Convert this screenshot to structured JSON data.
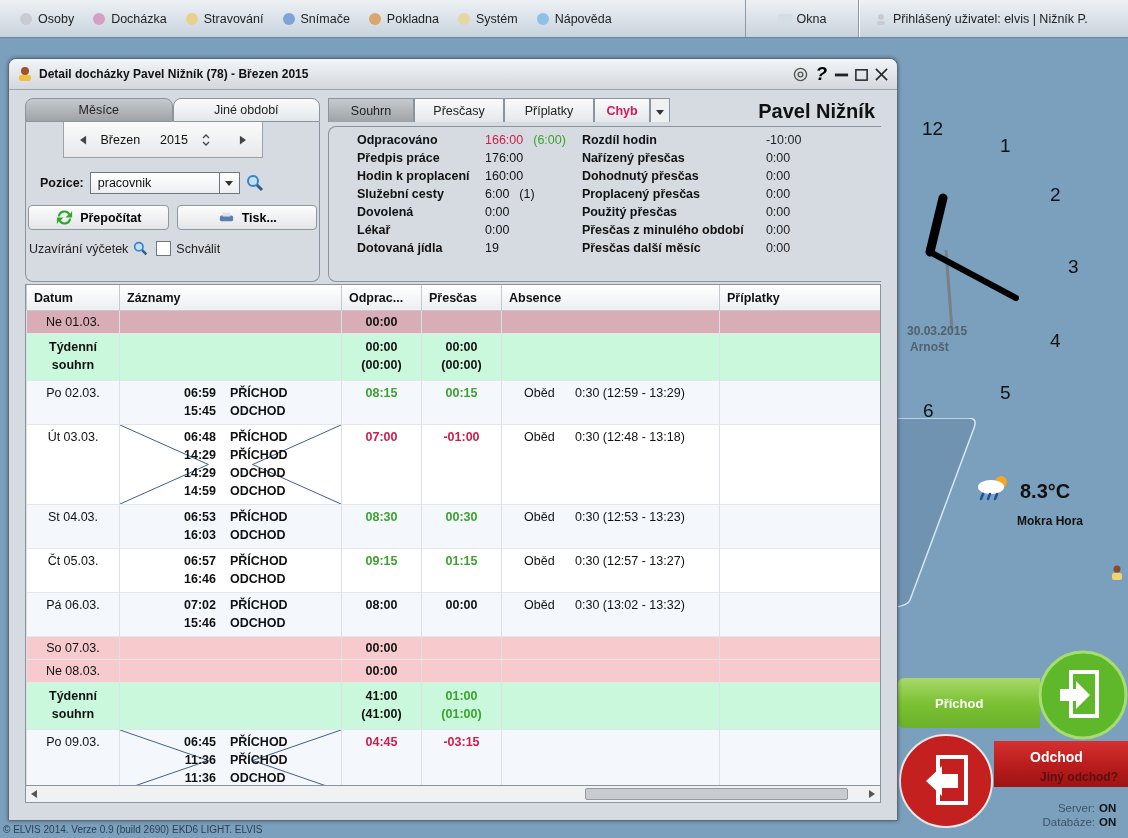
{
  "menu": {
    "items": [
      "Osoby",
      "Docházka",
      "Stravování",
      "Snímače",
      "Pokladna",
      "Systém",
      "Nápověda"
    ],
    "windows": "Okna",
    "user": "Přihlášený uživatel: elvis | Nižník P."
  },
  "dialog": {
    "title": "Detail docházky Pavel Nižník (78) - Březen 2015",
    "help": "?",
    "period_tabs": [
      {
        "label": "Měsíce",
        "selected": true
      },
      {
        "label": "Jiné období",
        "selected": false
      }
    ],
    "month": "Březen",
    "year": "2015",
    "position_label": "Pozice:",
    "position": "pracovnik",
    "recalc": "Přepočítat",
    "print": "Tisk...",
    "closing_label": "Uzavírání výčetek",
    "approve": {
      "label": "Schválit",
      "checked": false
    },
    "tabs": [
      {
        "label": "Souhrn",
        "selected": true,
        "kind": "normal"
      },
      {
        "label": "Přesčasy",
        "selected": false,
        "kind": "normal"
      },
      {
        "label": "Příplatky",
        "selected": false,
        "kind": "normal"
      },
      {
        "label": "Chyb",
        "selected": false,
        "kind": "error"
      }
    ],
    "person": "Pavel Nižník",
    "summary_left": [
      {
        "label": "Odpracováno",
        "parts": [
          {
            "text": "166:00",
            "color": "#d01c4a"
          },
          {
            "text": "(6:00)",
            "color": "#3aa32e"
          }
        ]
      },
      {
        "label": "Předpis práce",
        "parts": [
          {
            "text": "176:00",
            "color": "#111111"
          }
        ]
      },
      {
        "label": "Hodin k proplacení",
        "parts": [
          {
            "text": "160:00",
            "color": "#111111"
          }
        ]
      },
      {
        "label": "Služební cesty",
        "parts": [
          {
            "text": "6:00",
            "color": "#111111"
          },
          {
            "text": "(1)",
            "color": "#111111"
          }
        ]
      },
      {
        "label": "Dovolená",
        "parts": [
          {
            "text": "0:00",
            "color": "#111111"
          }
        ]
      },
      {
        "label": "Lékař",
        "parts": [
          {
            "text": "0:00",
            "color": "#111111"
          }
        ]
      },
      {
        "label": "Dotovaná jídla",
        "parts": [
          {
            "text": "19",
            "color": "#111111"
          }
        ]
      }
    ],
    "summary_right": [
      {
        "label": "Rozdíl hodin",
        "value": "-10:00"
      },
      {
        "label": "Nařízený přesčas",
        "value": "0:00"
      },
      {
        "label": "Dohodnutý přesčas",
        "value": "0:00"
      },
      {
        "label": "Proplacený přesčas",
        "value": "0:00"
      },
      {
        "label": "Použitý přesčas",
        "value": "0:00"
      },
      {
        "label": "Přesčas z minulého období",
        "value": "0:00"
      },
      {
        "label": "Přesčas další měsíc",
        "value": "0:00"
      }
    ],
    "columns": [
      "Datum",
      "Záznamy",
      "Odprac...",
      "Přesčas",
      "Absence",
      "Příplatky"
    ],
    "rows": [
      {
        "kind": "weekend",
        "selected": true,
        "date": "Ne 01.03.",
        "records": [],
        "worked": {
          "lines": [
            "00:00"
          ],
          "color": "#111111"
        },
        "crossed": false
      },
      {
        "kind": "week_summary",
        "selected": false,
        "date": "Týdenní souhrn",
        "records": [],
        "worked": {
          "lines": [
            "00:00",
            "(00:00)"
          ],
          "color": "#111111"
        },
        "overtime": {
          "lines": [
            "00:00",
            "(00:00)"
          ],
          "color": "#111111"
        },
        "crossed": false
      },
      {
        "kind": "day",
        "selected": false,
        "date": "Po 02.03.",
        "records": [
          {
            "time": "06:59",
            "type": "PŘÍCHOD"
          },
          {
            "time": "15:45",
            "type": "ODCHOD"
          }
        ],
        "worked": {
          "lines": [
            "08:15"
          ],
          "color": "#3aa32e"
        },
        "overtime": {
          "lines": [
            "00:15"
          ],
          "color": "#3aa32e"
        },
        "absence": {
          "type": "Oběd",
          "time": "0:30 (12:59 - 13:29)"
        },
        "crossed": false
      },
      {
        "kind": "day",
        "selected": false,
        "date": "Út 03.03.",
        "records": [
          {
            "time": "06:48",
            "type": "PŘÍCHOD"
          },
          {
            "time": "14:29",
            "type": "PŘÍCHOD"
          },
          {
            "time": "14:29",
            "type": "ODCHOD"
          },
          {
            "time": "14:59",
            "type": "ODCHOD"
          }
        ],
        "worked": {
          "lines": [
            "07:00"
          ],
          "color": "#d01c4a"
        },
        "overtime": {
          "lines": [
            "-01:00"
          ],
          "color": "#d01c4a"
        },
        "absence": {
          "type": "Oběd",
          "time": "0:30 (12:48 - 13:18)"
        },
        "crossed": true
      },
      {
        "kind": "day",
        "selected": false,
        "date": "St 04.03.",
        "records": [
          {
            "time": "06:53",
            "type": "PŘÍCHOD"
          },
          {
            "time": "16:03",
            "type": "ODCHOD"
          }
        ],
        "worked": {
          "lines": [
            "08:30"
          ],
          "color": "#3aa32e"
        },
        "overtime": {
          "lines": [
            "00:30"
          ],
          "color": "#3aa32e"
        },
        "absence": {
          "type": "Oběd",
          "time": "0:30 (12:53 - 13:23)"
        },
        "crossed": false
      },
      {
        "kind": "day",
        "selected": false,
        "date": "Čt 05.03.",
        "records": [
          {
            "time": "06:57",
            "type": "PŘÍCHOD"
          },
          {
            "time": "16:46",
            "type": "ODCHOD"
          }
        ],
        "worked": {
          "lines": [
            "09:15"
          ],
          "color": "#3aa32e"
        },
        "overtime": {
          "lines": [
            "01:15"
          ],
          "color": "#3aa32e"
        },
        "absence": {
          "type": "Oběd",
          "time": "0:30 (12:57 - 13:27)"
        },
        "crossed": false
      },
      {
        "kind": "day",
        "selected": false,
        "date": "Pá 06.03.",
        "records": [
          {
            "time": "07:02",
            "type": "PŘÍCHOD"
          },
          {
            "time": "15:46",
            "type": "ODCHOD"
          }
        ],
        "worked": {
          "lines": [
            "08:00"
          ],
          "color": "#111111"
        },
        "overtime": {
          "lines": [
            "00:00"
          ],
          "color": "#111111"
        },
        "absence": {
          "type": "Oběd",
          "time": "0:30 (13:02 - 13:32)"
        },
        "crossed": false
      },
      {
        "kind": "weekend",
        "selected": false,
        "date": "So 07.03.",
        "records": [],
        "worked": {
          "lines": [
            "00:00"
          ],
          "color": "#111111"
        },
        "crossed": false
      },
      {
        "kind": "weekend",
        "selected": false,
        "date": "Ne 08.03.",
        "records": [],
        "worked": {
          "lines": [
            "00:00"
          ],
          "color": "#111111"
        },
        "crossed": false
      },
      {
        "kind": "week_summary",
        "selected": false,
        "date": "Týdenní souhrn",
        "records": [],
        "worked": {
          "lines": [
            "41:00",
            "(41:00)"
          ],
          "color": "#111111"
        },
        "overtime": {
          "lines": [
            "01:00",
            "(01:00)"
          ],
          "color": "#3aa32e"
        },
        "crossed": false
      },
      {
        "kind": "day",
        "selected": false,
        "date": "Po 09.03.",
        "records": [
          {
            "time": "06:45",
            "type": "PŘÍCHOD"
          },
          {
            "time": "11:36",
            "type": "PŘÍCHOD"
          },
          {
            "time": "11:36",
            "type": "ODCHOD"
          }
        ],
        "worked": {
          "lines": [
            "04:45"
          ],
          "color": "#d01c4a"
        },
        "overtime": {
          "lines": [
            "-03:15"
          ],
          "color": "#d01c4a"
        },
        "crossed": true
      }
    ]
  },
  "clock": {
    "numbers": [
      "12",
      "1",
      "2",
      "3",
      "4",
      "5",
      "6"
    ]
  },
  "event": {
    "date": "30.03.2015",
    "name": "Arnošt"
  },
  "weather": {
    "temperature": "8.3°C",
    "place": "Mokra Hora"
  },
  "arrival": "Příchod",
  "departure": "Odchod",
  "other_departure": "Jiný odchod?",
  "status": [
    {
      "label": "Server:",
      "value": "ON"
    },
    {
      "label": "Databáze:",
      "value": "ON"
    }
  ],
  "footer": "© ELVIS 2014. Verze 0.9 (build 2690) EKD6 LIGHT. ELVIS"
}
